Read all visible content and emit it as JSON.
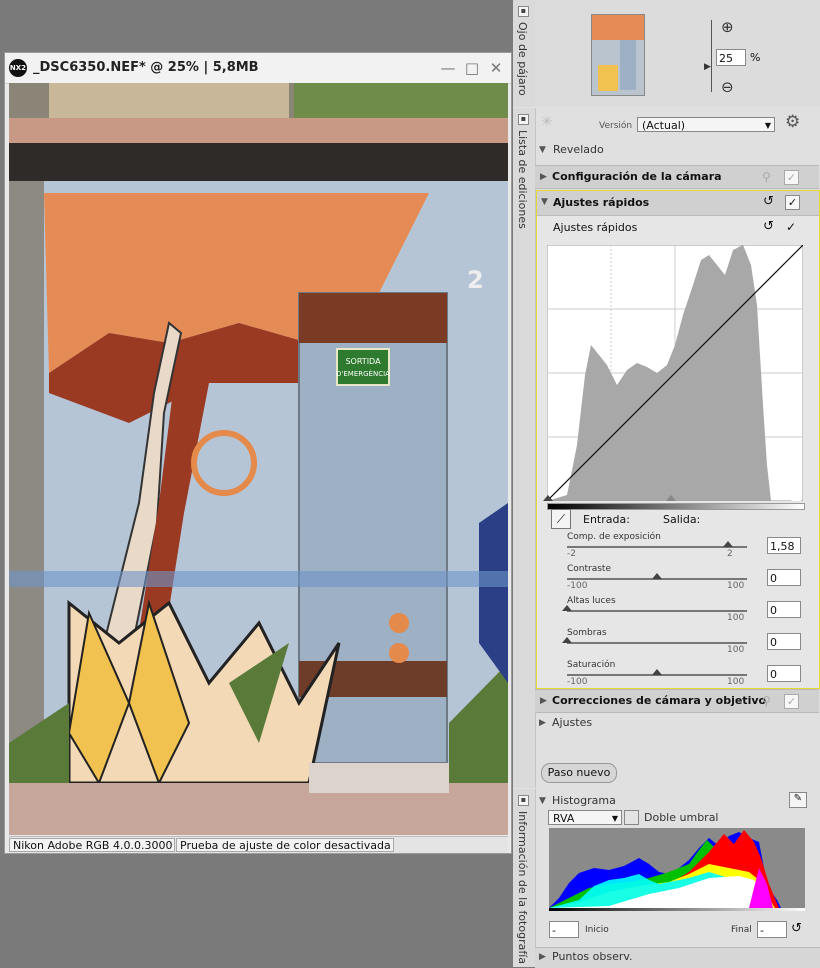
{
  "image_window": {
    "logo": "NX2",
    "title": "_DSC6350.NEF* @ 25% | 5,8MB",
    "buttons": {
      "minimize": "—",
      "maximize": "□",
      "close": "✕"
    },
    "status": {
      "profile": "Nikon Adobe RGB 4.0.0.3000",
      "softproof": "Prueba de ajuste de color desactivada"
    },
    "photo_text": {
      "sign": "SORTIDA D'EMERGÈNCIA",
      "number": "2"
    }
  },
  "birds_eye": {
    "label": "Ojo de pájaro",
    "zoom_value": "25",
    "zoom_unit": "%",
    "zoom_in_icon": "⊕",
    "zoom_out_icon": "⊖"
  },
  "edit_list": {
    "label": "Lista de ediciones",
    "version_label": "Versión",
    "version_value": "(Actual)",
    "revelado": "Revelado",
    "camera_settings": "Configuración de la cámara",
    "quick_fix": "Ajustes rápidos",
    "quick_fix_sub": "Ajustes rápidos",
    "entrada": "Entrada:",
    "salida": "Salida:",
    "sliders": [
      {
        "label": "Comp. de exposición",
        "min": "-2",
        "max": "2",
        "value": "1,58",
        "fraction": 0.895
      },
      {
        "label": "Contraste",
        "min": "-100",
        "max": "100",
        "value": "0",
        "fraction": 0.5
      },
      {
        "label": "Altas luces",
        "min": "",
        "max": "100",
        "value": "0",
        "fraction": 0.0
      },
      {
        "label": "Sombras",
        "min": "",
        "max": "100",
        "value": "0",
        "fraction": 0.0
      },
      {
        "label": "Saturación",
        "min": "-100",
        "max": "100",
        "value": "0",
        "fraction": 0.5
      }
    ],
    "camera_lens": "Correcciones de cámara y objetivo",
    "ajustes": "Ajustes",
    "new_step": "Paso nuevo"
  },
  "photo_info": {
    "label": "Información de la fotografía",
    "histogram_title": "Histograma",
    "channel": "RVA",
    "double_threshold": "Doble umbral",
    "start_label": "Inicio",
    "end_label": "Final",
    "start_value": "-",
    "end_value": "-",
    "watch_points": "Puntos observ."
  },
  "colors": {
    "panel_bg": "#e0e0e0",
    "bar_bg": "#d0d0d0",
    "highlight": "#e8d830",
    "desktop": "#7a7a7a"
  }
}
